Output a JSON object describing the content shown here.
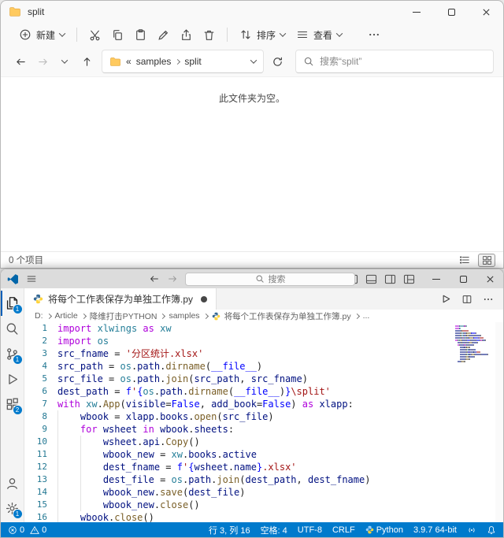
{
  "explorer": {
    "window_title": "split",
    "toolbar": {
      "new_label": "新建",
      "sort_label": "排序",
      "view_label": "查看"
    },
    "nav": {
      "truncation_mark": "«",
      "crumbs": [
        "samples",
        "split"
      ]
    },
    "search_placeholder": "搜索“split”",
    "empty_message": "此文件夹为空。",
    "status_items_count": "0 个项目"
  },
  "vscode": {
    "command_center_placeholder": "搜索",
    "tab_title": "将每个工作表保存为单独工作簿.py",
    "breadcrumbs": [
      "D:",
      "Article",
      "降维打击PYTHON",
      "samples",
      "将每个工作表保存为单独工作簿.py",
      "..."
    ],
    "activity_badges": {
      "explorer": "1",
      "scm": "1",
      "extensions": "2",
      "settings": "1"
    },
    "editor": {
      "token_colors": {
        "k": "#af00db",
        "m": "#267f99",
        "v": "#001080",
        "f": "#795e26",
        "s": "#a31515",
        "c": "#0000ff",
        "o": "#1e1e1e"
      },
      "lines": [
        [
          [
            "k",
            "import"
          ],
          [
            "o",
            " "
          ],
          [
            "m",
            "xlwings"
          ],
          [
            "o",
            " "
          ],
          [
            "k",
            "as"
          ],
          [
            "o",
            " "
          ],
          [
            "m",
            "xw"
          ]
        ],
        [
          [
            "k",
            "import"
          ],
          [
            "o",
            " "
          ],
          [
            "m",
            "os"
          ]
        ],
        [
          [
            "v",
            "src_fname"
          ],
          [
            "o",
            " = "
          ],
          [
            "s",
            "'分区统计.xlsx'"
          ]
        ],
        [
          [
            "v",
            "src_path"
          ],
          [
            "o",
            " = "
          ],
          [
            "m",
            "os"
          ],
          [
            "o",
            "."
          ],
          [
            "v",
            "path"
          ],
          [
            "o",
            "."
          ],
          [
            "f",
            "dirname"
          ],
          [
            "o",
            "("
          ],
          [
            "c",
            "__file__"
          ],
          [
            "o",
            ")"
          ]
        ],
        [
          [
            "v",
            "src_file"
          ],
          [
            "o",
            " = "
          ],
          [
            "m",
            "os"
          ],
          [
            "o",
            "."
          ],
          [
            "v",
            "path"
          ],
          [
            "o",
            "."
          ],
          [
            "f",
            "join"
          ],
          [
            "o",
            "("
          ],
          [
            "v",
            "src_path"
          ],
          [
            "o",
            ", "
          ],
          [
            "v",
            "src_fname"
          ],
          [
            "o",
            ")"
          ]
        ],
        [
          [
            "v",
            "dest_path"
          ],
          [
            "o",
            " = "
          ],
          [
            "c",
            "f"
          ],
          [
            "s",
            "'"
          ],
          [
            "c",
            "{"
          ],
          [
            "m",
            "os"
          ],
          [
            "o",
            "."
          ],
          [
            "v",
            "path"
          ],
          [
            "o",
            "."
          ],
          [
            "f",
            "dirname"
          ],
          [
            "o",
            "("
          ],
          [
            "c",
            "__file__"
          ],
          [
            "o",
            ")"
          ],
          [
            "c",
            "}"
          ],
          [
            "s",
            "\\split'"
          ]
        ],
        [
          [
            "k",
            "with"
          ],
          [
            "o",
            " "
          ],
          [
            "m",
            "xw"
          ],
          [
            "o",
            "."
          ],
          [
            "f",
            "App"
          ],
          [
            "o",
            "("
          ],
          [
            "v",
            "visible"
          ],
          [
            "o",
            "="
          ],
          [
            "c",
            "False"
          ],
          [
            "o",
            ", "
          ],
          [
            "v",
            "add_book"
          ],
          [
            "o",
            "="
          ],
          [
            "c",
            "False"
          ],
          [
            "o",
            ") "
          ],
          [
            "k",
            "as"
          ],
          [
            "o",
            " "
          ],
          [
            "v",
            "xlapp"
          ],
          [
            "o",
            ":"
          ]
        ],
        [
          [
            "i",
            "    "
          ],
          [
            "v",
            "wbook"
          ],
          [
            "o",
            " = "
          ],
          [
            "v",
            "xlapp"
          ],
          [
            "o",
            "."
          ],
          [
            "v",
            "books"
          ],
          [
            "o",
            "."
          ],
          [
            "f",
            "open"
          ],
          [
            "o",
            "("
          ],
          [
            "v",
            "src_file"
          ],
          [
            "o",
            ")"
          ]
        ],
        [
          [
            "i",
            "    "
          ],
          [
            "k",
            "for"
          ],
          [
            "o",
            " "
          ],
          [
            "v",
            "wsheet"
          ],
          [
            "o",
            " "
          ],
          [
            "k",
            "in"
          ],
          [
            "o",
            " "
          ],
          [
            "v",
            "wbook"
          ],
          [
            "o",
            "."
          ],
          [
            "v",
            "sheets"
          ],
          [
            "o",
            ":"
          ]
        ],
        [
          [
            "i",
            "        "
          ],
          [
            "v",
            "wsheet"
          ],
          [
            "o",
            "."
          ],
          [
            "v",
            "api"
          ],
          [
            "o",
            "."
          ],
          [
            "f",
            "Copy"
          ],
          [
            "o",
            "()"
          ]
        ],
        [
          [
            "i",
            "        "
          ],
          [
            "v",
            "wbook_new"
          ],
          [
            "o",
            " = "
          ],
          [
            "m",
            "xw"
          ],
          [
            "o",
            "."
          ],
          [
            "v",
            "books"
          ],
          [
            "o",
            "."
          ],
          [
            "v",
            "active"
          ]
        ],
        [
          [
            "i",
            "        "
          ],
          [
            "v",
            "dest_fname"
          ],
          [
            "o",
            " = "
          ],
          [
            "c",
            "f"
          ],
          [
            "s",
            "'"
          ],
          [
            "c",
            "{"
          ],
          [
            "v",
            "wsheet"
          ],
          [
            "o",
            "."
          ],
          [
            "v",
            "name"
          ],
          [
            "c",
            "}"
          ],
          [
            "s",
            ".xlsx'"
          ]
        ],
        [
          [
            "i",
            "        "
          ],
          [
            "v",
            "dest_file"
          ],
          [
            "o",
            " = "
          ],
          [
            "m",
            "os"
          ],
          [
            "o",
            "."
          ],
          [
            "v",
            "path"
          ],
          [
            "o",
            "."
          ],
          [
            "f",
            "join"
          ],
          [
            "o",
            "("
          ],
          [
            "v",
            "dest_path"
          ],
          [
            "o",
            ", "
          ],
          [
            "v",
            "dest_fname"
          ],
          [
            "o",
            ")"
          ]
        ],
        [
          [
            "i",
            "        "
          ],
          [
            "v",
            "wbook_new"
          ],
          [
            "o",
            "."
          ],
          [
            "f",
            "save"
          ],
          [
            "o",
            "("
          ],
          [
            "v",
            "dest_file"
          ],
          [
            "o",
            ")"
          ]
        ],
        [
          [
            "i",
            "        "
          ],
          [
            "v",
            "wbook_new"
          ],
          [
            "o",
            "."
          ],
          [
            "f",
            "close"
          ],
          [
            "o",
            "()"
          ]
        ],
        [
          [
            "i",
            "    "
          ],
          [
            "v",
            "wbook"
          ],
          [
            "o",
            "."
          ],
          [
            "f",
            "close"
          ],
          [
            "o",
            "()"
          ]
        ]
      ]
    },
    "status_bar": {
      "errors": "0",
      "warnings": "0",
      "cursor": "行 3, 列 16",
      "indent": "空格: 4",
      "encoding": "UTF-8",
      "eol": "CRLF",
      "language": "Python",
      "interpreter": "3.9.7 64-bit"
    }
  }
}
